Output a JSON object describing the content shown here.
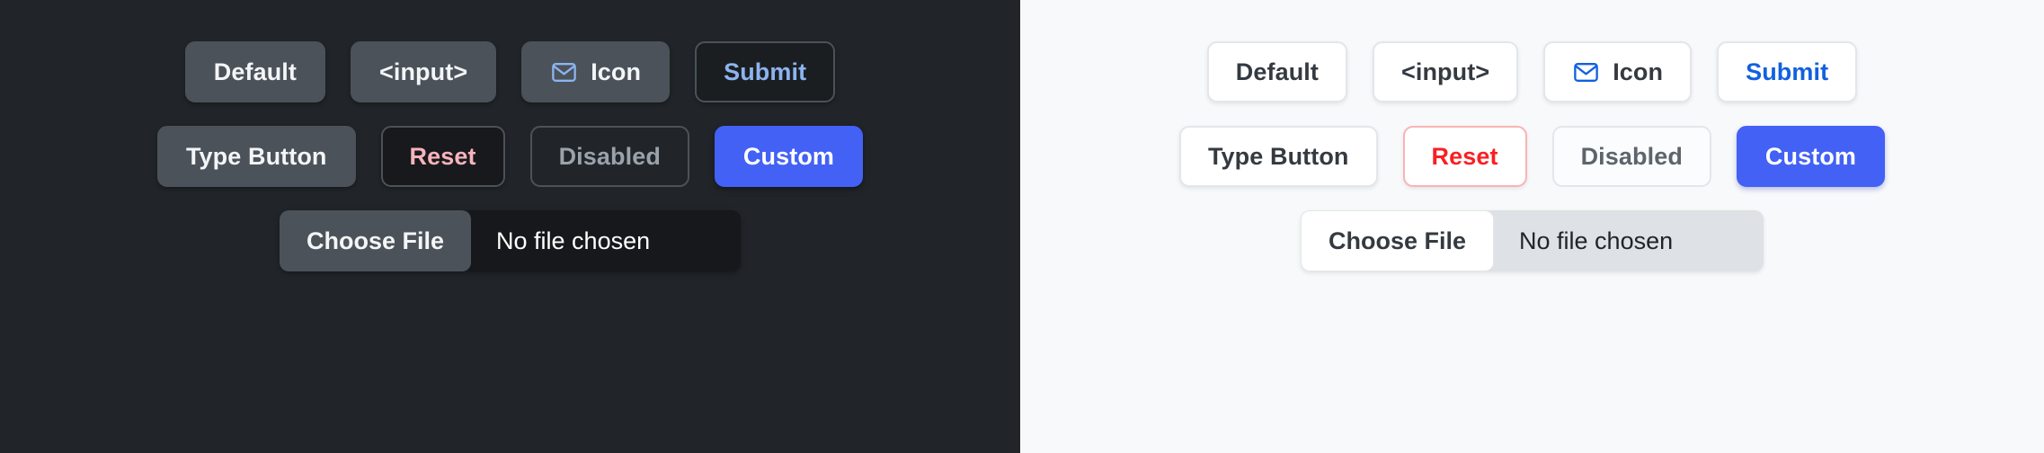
{
  "panels": [
    {
      "theme": "dark",
      "background": "#212529",
      "rows": [
        {
          "buttons": [
            {
              "label": "Default",
              "variant": "secondary",
              "icon": null
            },
            {
              "label": "<input>",
              "variant": "secondary",
              "icon": null
            },
            {
              "label": "Icon",
              "variant": "secondary",
              "icon": "envelope-icon"
            },
            {
              "label": "Submit",
              "variant": "outline-primary",
              "icon": null
            }
          ]
        },
        {
          "buttons": [
            {
              "label": "Type Button",
              "variant": "secondary",
              "icon": null
            },
            {
              "label": "Reset",
              "variant": "outline-danger",
              "icon": null
            },
            {
              "label": "Disabled",
              "variant": "disabled",
              "icon": null
            },
            {
              "label": "Custom",
              "variant": "custom",
              "icon": null
            }
          ]
        }
      ],
      "file_input": {
        "button_label": "Choose File",
        "status_text": "No file chosen"
      },
      "colors": {
        "secondary_bg": "#4b5259",
        "secondary_text": "#f3f5f7",
        "primary_text": "#8cb4f0",
        "danger_text": "#f7b3bd",
        "disabled_text": "#9aa2aa",
        "custom_bg": "#4361f5",
        "border": "#4b5259",
        "file_field_bg": "#16181b"
      }
    },
    {
      "theme": "light",
      "background": "#f8f9fa",
      "rows": [
        {
          "buttons": [
            {
              "label": "Default",
              "variant": "secondary",
              "icon": null
            },
            {
              "label": "<input>",
              "variant": "secondary",
              "icon": null
            },
            {
              "label": "Icon",
              "variant": "secondary",
              "icon": "envelope-icon"
            },
            {
              "label": "Submit",
              "variant": "outline-primary",
              "icon": null
            }
          ]
        },
        {
          "buttons": [
            {
              "label": "Type Button",
              "variant": "secondary",
              "icon": null
            },
            {
              "label": "Reset",
              "variant": "outline-danger",
              "icon": null
            },
            {
              "label": "Disabled",
              "variant": "disabled",
              "icon": null
            },
            {
              "label": "Custom",
              "variant": "custom",
              "icon": null
            }
          ]
        }
      ],
      "file_input": {
        "button_label": "Choose File",
        "status_text": "No file chosen"
      },
      "colors": {
        "secondary_bg": "#ffffff",
        "secondary_text": "#343a40",
        "primary_text": "#1160e0",
        "danger_text": "#fa1f22",
        "danger_border": "#f9b4b6",
        "disabled_text": "#5d646b",
        "custom_bg": "#4361f5",
        "border": "#e3e6ea",
        "file_field_bg": "#dee2e6"
      }
    }
  ]
}
